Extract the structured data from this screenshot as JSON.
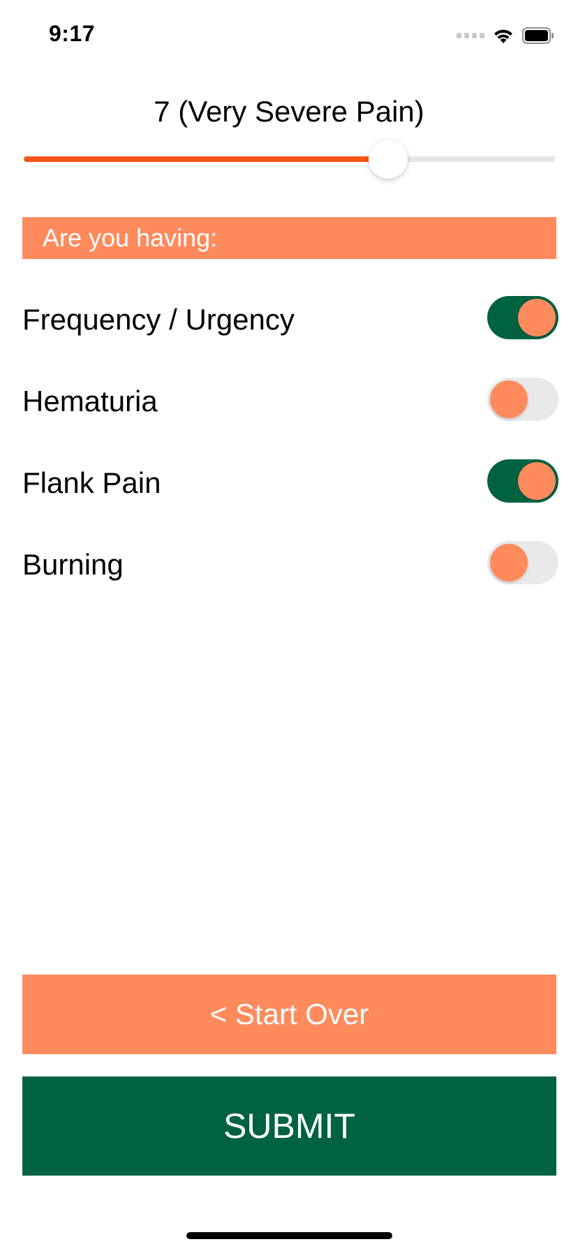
{
  "status_bar": {
    "time": "9:17"
  },
  "pain": {
    "label": "7 (Very Severe Pain)",
    "value": 7,
    "min": 0,
    "max": 10,
    "fill_color": "#f45516"
  },
  "symptoms": {
    "header": "Are you having:",
    "items": [
      {
        "label": "Frequency / Urgency",
        "on": true
      },
      {
        "label": "Hematuria",
        "on": false
      },
      {
        "label": "Flank Pain",
        "on": true
      },
      {
        "label": "Burning",
        "on": false
      }
    ]
  },
  "buttons": {
    "start_over": "< Start Over",
    "submit": "SUBMIT"
  },
  "colors": {
    "accent": "#ff8a5c",
    "primary": "#006241",
    "slider": "#f45516"
  },
  "icons": {
    "cellular": "cellular-signal-icon",
    "wifi": "wifi-icon",
    "battery": "battery-icon"
  }
}
